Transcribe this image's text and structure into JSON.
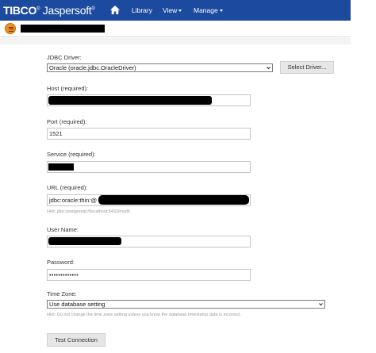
{
  "header": {
    "brand_tibco": "TIBC",
    "brand_name": "Jaspersoft",
    "nav": [
      {
        "label": "Library"
      },
      {
        "label": "View"
      },
      {
        "label": "Manage"
      }
    ],
    "accent": "#1c4a9e"
  },
  "form": {
    "jdbc_driver": {
      "label": "JDBC Driver:",
      "value": "Oracle (oracle.jdbc.OracleDriver)",
      "button": "Select Driver..."
    },
    "host": {
      "label": "Host (required):",
      "value": ""
    },
    "port": {
      "label": "Port (required):",
      "value": "1521"
    },
    "service": {
      "label": "Service (required):",
      "value": ""
    },
    "url": {
      "label": "URL (required):",
      "value": "jdbc:oracle:thin:@",
      "hint": "Hint: jdbc:postgresql://localhost:5432/mydb"
    },
    "user": {
      "label": "User Name:",
      "value": ""
    },
    "password": {
      "label": "Password:",
      "value": "•••••••••••••"
    },
    "timezone": {
      "label": "Time Zone:",
      "value": "Use database setting",
      "hint": "Hint: Do not change the time zone setting unless you know the database timestamp data is incorrect."
    },
    "test_button": "Test Connection"
  }
}
